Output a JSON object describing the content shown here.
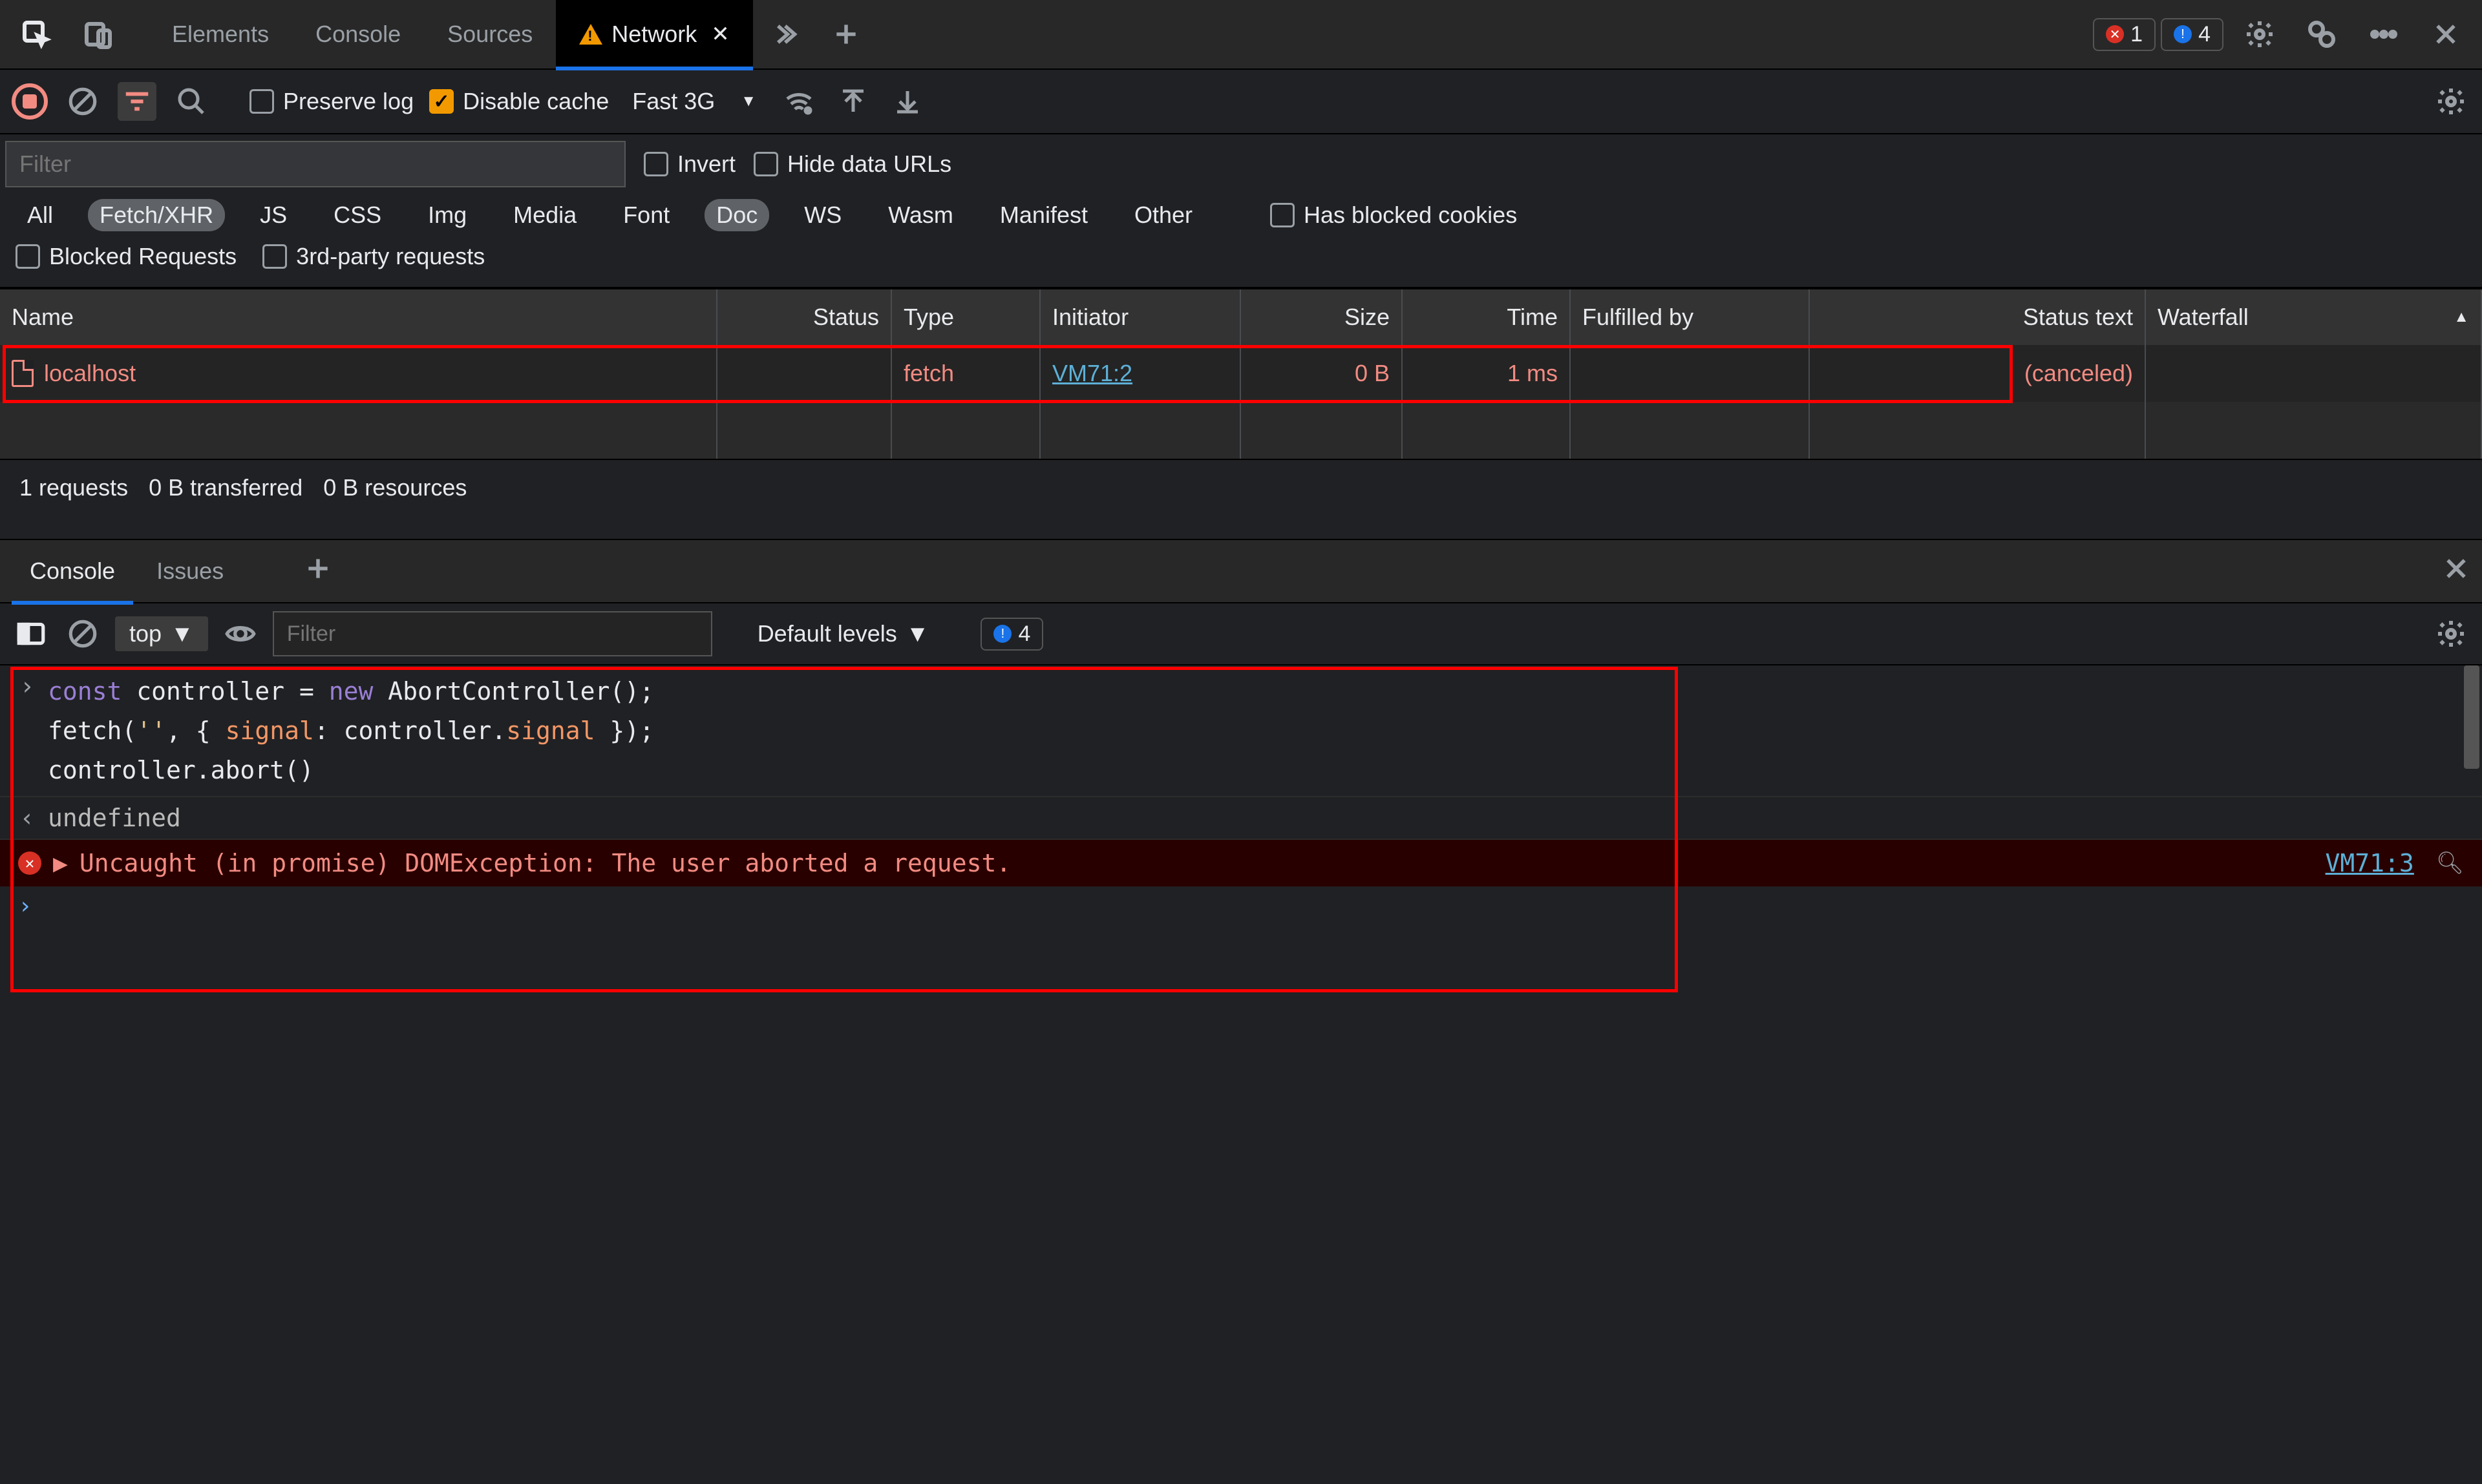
{
  "top": {
    "tabs": [
      "Elements",
      "Console",
      "Sources",
      "Network"
    ],
    "active_tab": "Network",
    "error_count": "1",
    "issue_count": "4"
  },
  "net_toolbar": {
    "preserve_log": "Preserve log",
    "disable_cache": "Disable cache",
    "throttling": "Fast 3G"
  },
  "net_filter": {
    "placeholder": "Filter",
    "invert": "Invert",
    "hide_data_urls": "Hide data URLs",
    "types": [
      "All",
      "Fetch/XHR",
      "JS",
      "CSS",
      "Img",
      "Media",
      "Font",
      "Doc",
      "WS",
      "Wasm",
      "Manifest",
      "Other"
    ],
    "active_types": [
      "Fetch/XHR",
      "Doc"
    ],
    "has_blocked_cookies": "Has blocked cookies",
    "blocked_requests": "Blocked Requests",
    "third_party": "3rd-party requests"
  },
  "net_table": {
    "columns": [
      "Name",
      "Status",
      "Type",
      "Initiator",
      "Size",
      "Time",
      "Fulfilled by",
      "Status text",
      "Waterfall"
    ],
    "row": {
      "name": "localhost",
      "status": "",
      "type": "fetch",
      "initiator": "VM71:2",
      "size": "0 B",
      "time": "1 ms",
      "fulfilled_by": "",
      "status_text": "(canceled)"
    },
    "summary": {
      "requests": "1 requests",
      "transferred": "0 B transferred",
      "resources": "0 B resources"
    }
  },
  "drawer": {
    "tabs": [
      "Console",
      "Issues"
    ],
    "active": "Console"
  },
  "console_toolbar": {
    "context": "top",
    "filter_placeholder": "Filter",
    "levels": "Default levels",
    "issues_count": "4"
  },
  "console": {
    "input_code": {
      "l1_kw1": "const",
      "l1_id": " controller ",
      "l1_eq": "= ",
      "l1_kw2": "new",
      "l1_ctor": " AbortController();",
      "l2a": "fetch(",
      "l2_str": "''",
      "l2b": ", { ",
      "l2_prop": "signal",
      "l2c": ": controller.",
      "l2_prop2": "signal",
      "l2d": " });",
      "l3": "controller.abort()"
    },
    "return_value": "undefined",
    "error_text": "Uncaught (in promise) DOMException: The user aborted a request.",
    "error_source": "VM71:3"
  }
}
